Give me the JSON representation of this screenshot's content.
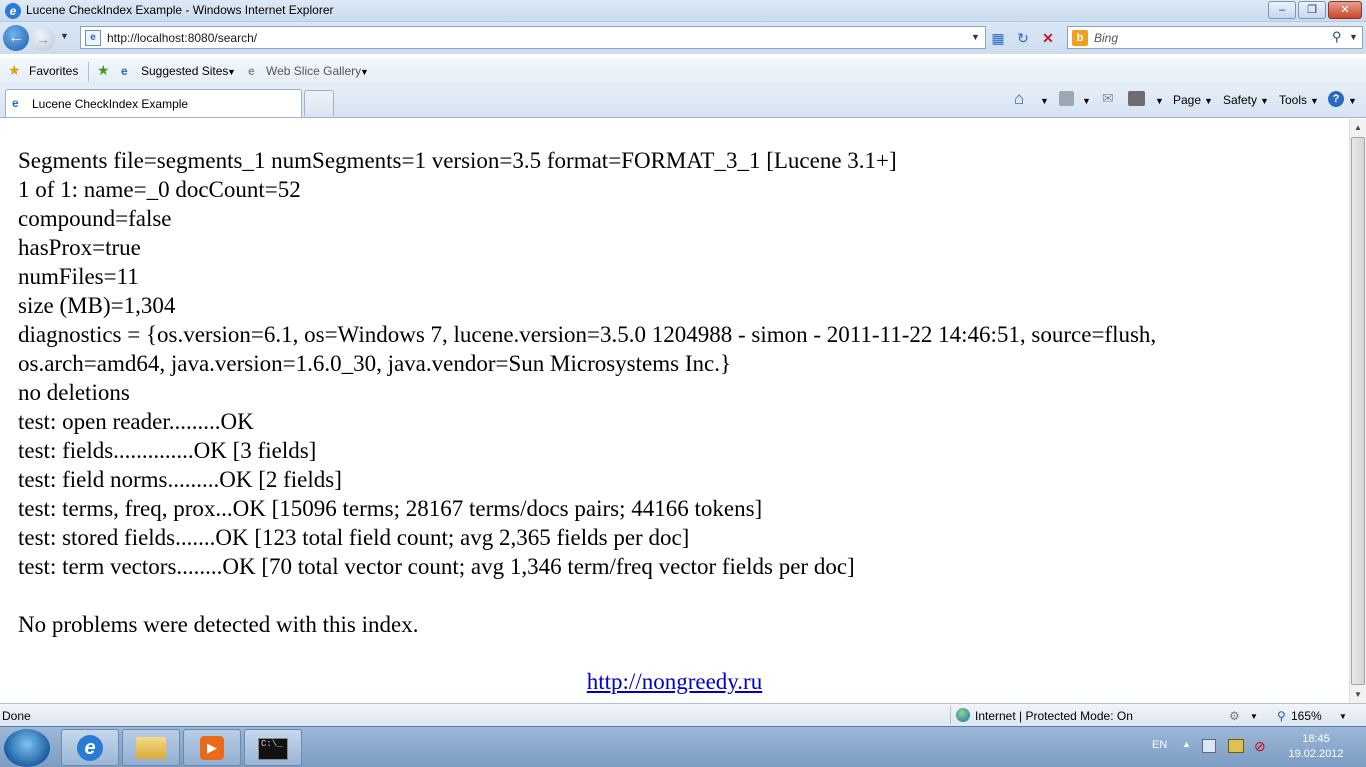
{
  "window": {
    "title": "Lucene CheckIndex Example - Windows Internet Explorer",
    "minimize_label": "–",
    "restore_label": "❐",
    "close_label": "✕"
  },
  "nav": {
    "url": "http://localhost:8080/search/",
    "search_placeholder": "Bing"
  },
  "favorites": {
    "favorites_label": "Favorites",
    "suggested_sites_label": "Suggested Sites",
    "web_slice_label": "Web Slice Gallery"
  },
  "tabs": {
    "active_tab_label": "Lucene CheckIndex Example"
  },
  "commandbar": {
    "page_label": "Page",
    "safety_label": "Safety",
    "tools_label": "Tools"
  },
  "report": {
    "lines": [
      "Segments file=segments_1 numSegments=1 version=3.5 format=FORMAT_3_1 [Lucene 3.1+]",
      "1 of 1: name=_0 docCount=52",
      "compound=false",
      "hasProx=true",
      "numFiles=11",
      "size (MB)=1,304",
      "diagnostics = {os.version=6.1, os=Windows 7, lucene.version=3.5.0 1204988 - simon - 2011-11-22 14:46:51, source=flush,",
      "os.arch=amd64, java.version=1.6.0_30, java.vendor=Sun Microsystems Inc.}",
      "no deletions",
      "test: open reader.........OK",
      "test: fields..............OK [3 fields]",
      "test: field norms.........OK [2 fields]",
      "test: terms, freq, prox...OK [15096 terms; 28167 terms/docs pairs; 44166 tokens]",
      "test: stored fields.......OK [123 total field count; avg 2,365 fields per doc]",
      "test: term vectors........OK [70 total vector count; avg 1,346 term/freq vector fields per doc]",
      "",
      "No problems were detected with this index."
    ],
    "link_text": "http://nongreedy.ru"
  },
  "status": {
    "left_text": "Done",
    "zone_text": "Internet | Protected Mode: On",
    "zoom_text": "165%"
  },
  "taskbar": {
    "language": "EN",
    "time": "18:45",
    "date": "19.02.2012"
  }
}
